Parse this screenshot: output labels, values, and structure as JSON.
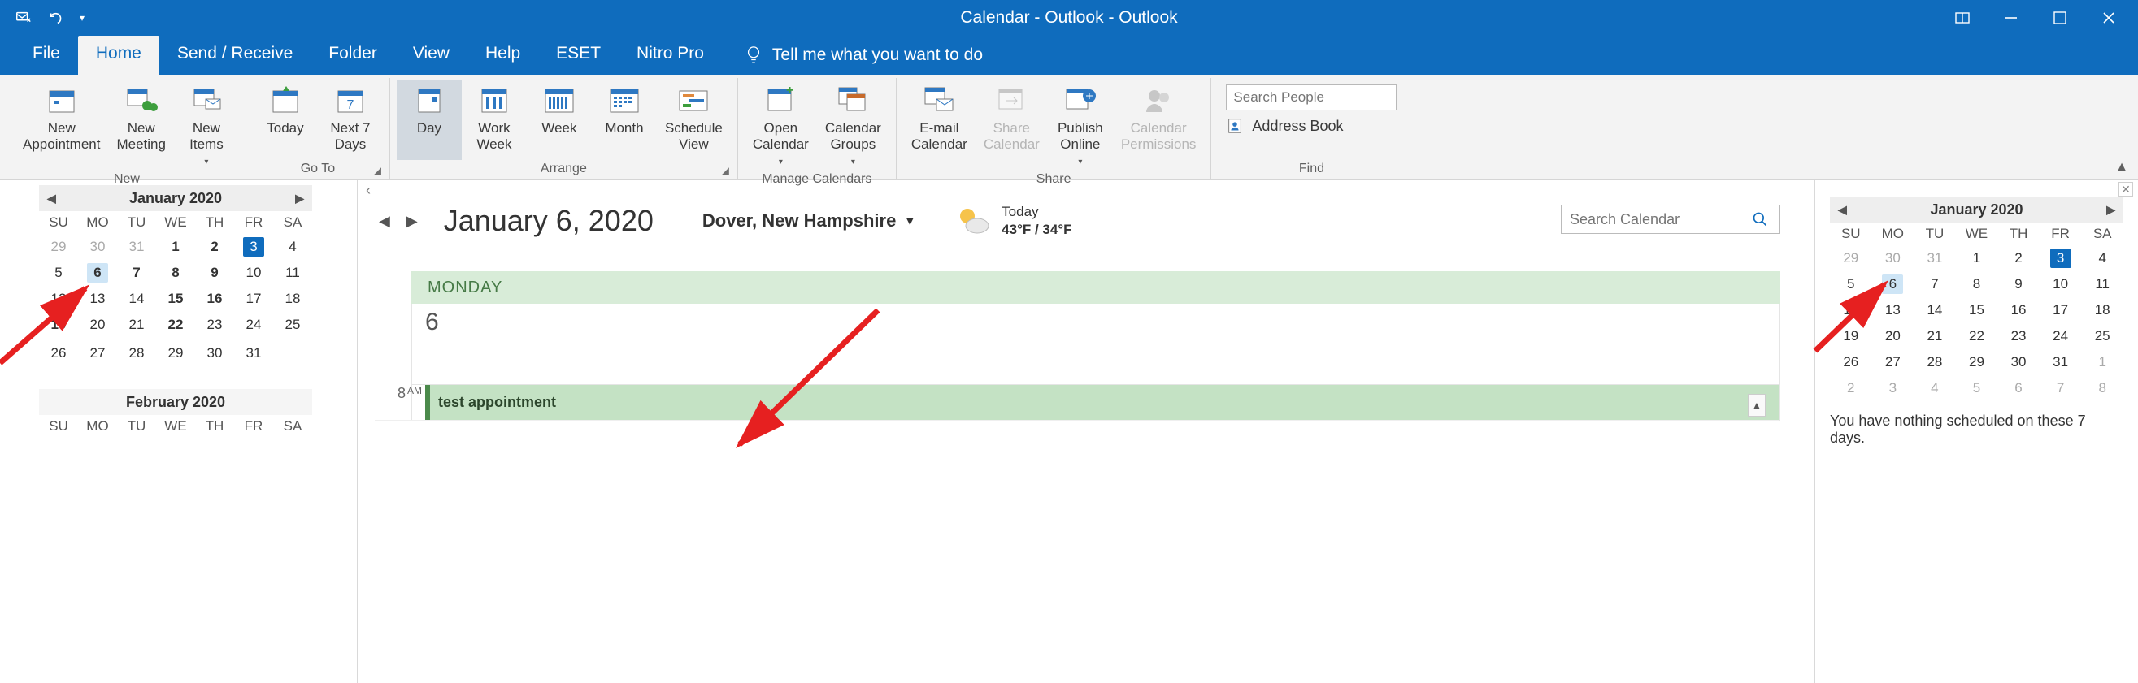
{
  "titlebar": {
    "title": "Calendar - Outlook  -  Outlook"
  },
  "tabs": {
    "file": "File",
    "home": "Home",
    "sendrecv": "Send / Receive",
    "folder": "Folder",
    "view": "View",
    "help": "Help",
    "eset": "ESET",
    "nitro": "Nitro Pro",
    "tellme": "Tell me what you want to do"
  },
  "ribbon": {
    "groups": {
      "new": {
        "name": "New",
        "new_appt": "New\nAppointment",
        "new_meeting": "New\nMeeting",
        "new_items": "New\nItems"
      },
      "goto": {
        "name": "Go To",
        "today": "Today",
        "next7": "Next 7\nDays"
      },
      "arrange": {
        "name": "Arrange",
        "day": "Day",
        "workweek": "Work\nWeek",
        "week": "Week",
        "month": "Month",
        "schedule": "Schedule\nView"
      },
      "manage": {
        "name": "Manage Calendars",
        "open": "Open\nCalendar",
        "groups": "Calendar\nGroups"
      },
      "share": {
        "name": "Share",
        "email": "E-mail\nCalendar",
        "share": "Share\nCalendar",
        "publish": "Publish\nOnline",
        "perms": "Calendar\nPermissions"
      },
      "find": {
        "name": "Find",
        "placeholder": "Search People",
        "abook": "Address Book"
      }
    }
  },
  "leftcal": {
    "month1": "January 2020",
    "dow": [
      "SU",
      "MO",
      "TU",
      "WE",
      "TH",
      "FR",
      "SA"
    ],
    "weeks1": [
      [
        {
          "d": "29",
          "mute": true
        },
        {
          "d": "30",
          "mute": true
        },
        {
          "d": "31",
          "mute": true
        },
        {
          "d": "1",
          "bold": true
        },
        {
          "d": "2",
          "bold": true
        },
        {
          "d": "3",
          "today": true
        },
        {
          "d": "4"
        }
      ],
      [
        {
          "d": "5"
        },
        {
          "d": "6",
          "sel": true,
          "bold": true
        },
        {
          "d": "7",
          "bold": true
        },
        {
          "d": "8",
          "bold": true
        },
        {
          "d": "9",
          "bold": true
        },
        {
          "d": "10"
        },
        {
          "d": "11"
        }
      ],
      [
        {
          "d": "12"
        },
        {
          "d": "13"
        },
        {
          "d": "14"
        },
        {
          "d": "15",
          "bold": true
        },
        {
          "d": "16",
          "bold": true
        },
        {
          "d": "17"
        },
        {
          "d": "18"
        }
      ],
      [
        {
          "d": "19",
          "bold": true
        },
        {
          "d": "20"
        },
        {
          "d": "21"
        },
        {
          "d": "22",
          "bold": true
        },
        {
          "d": "23"
        },
        {
          "d": "24"
        },
        {
          "d": "25"
        }
      ],
      [
        {
          "d": "26"
        },
        {
          "d": "27"
        },
        {
          "d": "28"
        },
        {
          "d": "29"
        },
        {
          "d": "30"
        },
        {
          "d": "31"
        },
        {
          "d": ""
        }
      ]
    ],
    "month2": "February 2020"
  },
  "center": {
    "date": "January 6, 2020",
    "location": "Dover, New Hampshire",
    "today_label": "Today",
    "temps": "43°F / 34°F",
    "search_placeholder": "Search Calendar",
    "dayname": "MONDAY",
    "daynum": "6",
    "slot_time": "8",
    "slot_ampm": "AM",
    "appt_title": "test appointment"
  },
  "rightcal": {
    "month": "January 2020",
    "dow": [
      "SU",
      "MO",
      "TU",
      "WE",
      "TH",
      "FR",
      "SA"
    ],
    "weeks": [
      [
        {
          "d": "29",
          "mute": true
        },
        {
          "d": "30",
          "mute": true
        },
        {
          "d": "31",
          "mute": true
        },
        {
          "d": "1"
        },
        {
          "d": "2"
        },
        {
          "d": "3",
          "today": true
        },
        {
          "d": "4"
        }
      ],
      [
        {
          "d": "5"
        },
        {
          "d": "6",
          "sel": true
        },
        {
          "d": "7"
        },
        {
          "d": "8"
        },
        {
          "d": "9"
        },
        {
          "d": "10"
        },
        {
          "d": "11"
        }
      ],
      [
        {
          "d": "12"
        },
        {
          "d": "13"
        },
        {
          "d": "14"
        },
        {
          "d": "15"
        },
        {
          "d": "16"
        },
        {
          "d": "17"
        },
        {
          "d": "18"
        }
      ],
      [
        {
          "d": "19"
        },
        {
          "d": "20"
        },
        {
          "d": "21"
        },
        {
          "d": "22"
        },
        {
          "d": "23"
        },
        {
          "d": "24"
        },
        {
          "d": "25"
        }
      ],
      [
        {
          "d": "26"
        },
        {
          "d": "27"
        },
        {
          "d": "28"
        },
        {
          "d": "29"
        },
        {
          "d": "30"
        },
        {
          "d": "31"
        },
        {
          "d": "1",
          "mute": true
        }
      ],
      [
        {
          "d": "2",
          "mute": true
        },
        {
          "d": "3",
          "mute": true
        },
        {
          "d": "4",
          "mute": true
        },
        {
          "d": "5",
          "mute": true
        },
        {
          "d": "6",
          "mute": true
        },
        {
          "d": "7",
          "mute": true
        },
        {
          "d": "8",
          "mute": true
        }
      ]
    ],
    "message": "You have nothing scheduled on these 7 days."
  }
}
